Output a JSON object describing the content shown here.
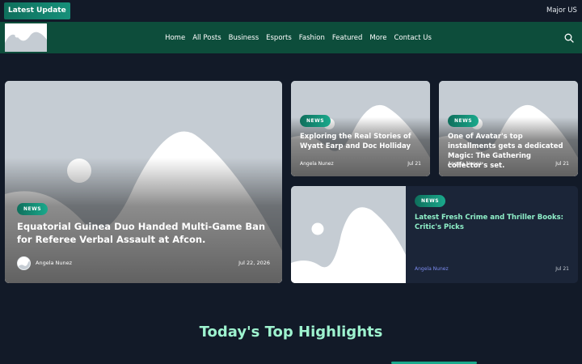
{
  "ticker": {
    "label": "Latest Update",
    "text": "Major US"
  },
  "nav": {
    "items": [
      "Home",
      "All Posts",
      "Business",
      "Esports",
      "Fashion",
      "Featured",
      "More",
      "Contact Us"
    ]
  },
  "icons": {
    "logo": "logo-image",
    "search": "search-icon",
    "avatar": "avatar-image"
  },
  "colors": {
    "header": "#0d4d3b",
    "background": "#121a28",
    "accent": "#16907a",
    "heading": "#9ef3cf",
    "author_link": "#7c8cf0"
  },
  "featured": {
    "badge": "NEWS",
    "title": "Equatorial Guinea Duo Handed Multi-Game Ban for Referee Verbal Assault at Afcon.",
    "author": "Angela Nunez",
    "date": "Jul 22, 2026"
  },
  "cards": [
    {
      "badge": "NEWS",
      "title": "Exploring the Real Stories of Wyatt Earp and Doc Holliday",
      "author": "Angela Nunez",
      "date": "Jul 21"
    },
    {
      "badge": "NEWS",
      "title": "One of Avatar's top installments gets a dedicated Magic: The Gathering collector's set.",
      "author": "Angela Nunez",
      "date": "Jul 21"
    },
    {
      "badge": "NEWS",
      "title": "Latest Fresh Crime and Thriller Books: Critic's Picks",
      "author": "Angela Nunez",
      "date": "Jul 21"
    }
  ],
  "section": {
    "title": "Today's Top Highlights"
  }
}
